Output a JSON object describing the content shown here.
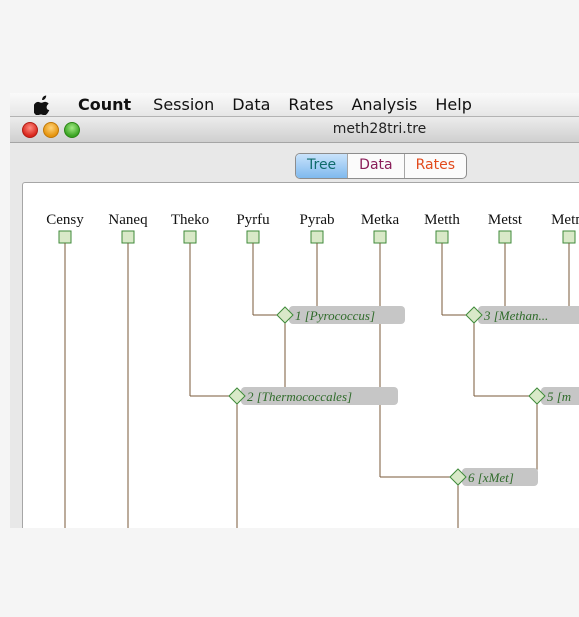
{
  "menubar": {
    "app_name": "Count",
    "items": [
      "Session",
      "Data",
      "Rates",
      "Analysis",
      "Help"
    ]
  },
  "window": {
    "title": "meth28tri.tre"
  },
  "tabs": [
    {
      "label": "Tree",
      "active": true
    },
    {
      "label": "Data",
      "active": false
    },
    {
      "label": "Rates",
      "active": false
    }
  ],
  "tree": {
    "leaves": [
      "Censy",
      "Naneq",
      "Theko",
      "Pyrfu",
      "Pyrab",
      "Metka",
      "Metth",
      "Metst",
      "Metm"
    ],
    "nodes": [
      {
        "label": "1 [Pyrococcus]"
      },
      {
        "label": "3 [Methan..."
      },
      {
        "label": "2 [Thermococcales]"
      },
      {
        "label": "5 [m"
      },
      {
        "label": "6 [xMet]"
      }
    ]
  },
  "colors": {
    "leaf_box_fill": "#d9e9c8",
    "leaf_box_stroke": "#3f8a3a",
    "branch": "#7a5a3a",
    "node_label_bg": "#c6c6c6",
    "node_label_text": "#2f6b2a",
    "tab_active": "#7fb9ee"
  }
}
